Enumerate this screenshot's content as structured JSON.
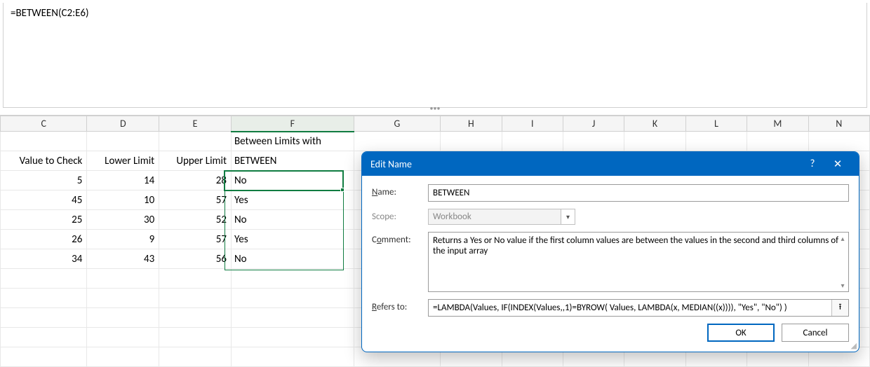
{
  "formula_bar": {
    "text": "=BETWEEN(C2:E6)"
  },
  "columns": [
    "C",
    "D",
    "E",
    "F",
    "G",
    "H",
    "I",
    "J",
    "K",
    "L",
    "M",
    "N"
  ],
  "header_row": {
    "C": "Value to Check",
    "D": "Lower Limit",
    "E": "Upper Limit",
    "F_line1": "Between Limits with",
    "F_line2": "BETWEEN"
  },
  "chart_data": {
    "type": "table",
    "columns": [
      "Value to Check",
      "Lower Limit",
      "Upper Limit",
      "Between Limits with BETWEEN"
    ],
    "rows": [
      {
        "value": 5,
        "lower": 14,
        "upper": 28,
        "result": "No"
      },
      {
        "value": 45,
        "lower": 10,
        "upper": 57,
        "result": "Yes"
      },
      {
        "value": 25,
        "lower": 30,
        "upper": 52,
        "result": "No"
      },
      {
        "value": 26,
        "lower": 9,
        "upper": 57,
        "result": "Yes"
      },
      {
        "value": 34,
        "lower": 43,
        "upper": 56,
        "result": "No"
      }
    ]
  },
  "dialog": {
    "title": "Edit Name",
    "labels": {
      "name": "Name:",
      "scope": "Scope:",
      "comment": "Comment:",
      "refers_to": "Refers to:"
    },
    "name_value": "BETWEEN",
    "scope_value": "Workbook",
    "comment_value": "Returns a Yes or No value if the first column values are between the values in the second and third columns of the input array",
    "refers_to_value": "=LAMBDA(Values, IF(INDEX(Values,,1)=BYROW( Values, LAMBDA(x, MEDIAN((x)))), \"Yes\", \"No\") )",
    "ok_label": "OK",
    "cancel_label": "Cancel",
    "help_glyph": "?",
    "close_glyph": "✕"
  }
}
